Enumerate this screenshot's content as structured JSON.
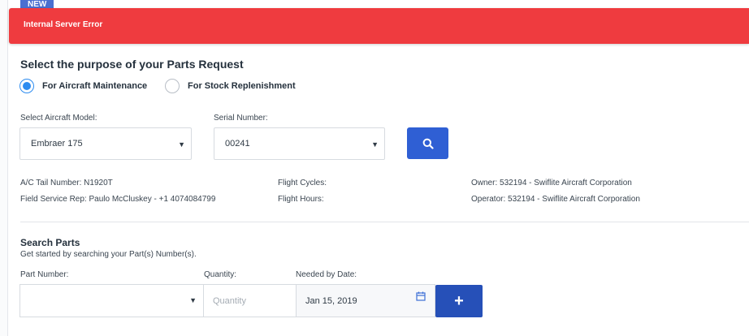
{
  "badge": {
    "new": "NEW"
  },
  "alert": {
    "message": "Internal Server Error",
    "color": "#ef3b3f"
  },
  "purpose": {
    "title": "Select the purpose of your Parts Request",
    "options": [
      {
        "label": "For Aircraft Maintenance",
        "selected": true
      },
      {
        "label": "For Stock Replenishment",
        "selected": false
      }
    ]
  },
  "aircraft": {
    "model_label": "Select Aircraft Model:",
    "model_value": "Embraer 175",
    "serial_label": "Serial Number:",
    "serial_value": "00241",
    "search_icon": "search-icon"
  },
  "details": {
    "tail_number": "A/C Tail Number: N1920T",
    "field_rep": "Field Service Rep: Paulo McCluskey - +1 4074084799",
    "flight_cycles": "Flight Cycles:",
    "flight_hours": "Flight Hours:",
    "owner": "Owner: 532194 - Swiflite Aircraft Corporation",
    "operator": "Operator: 532194 - Swiflite Aircraft Corporation"
  },
  "search_parts": {
    "title": "Search Parts",
    "subtitle": "Get started by searching your Part(s) Number(s).",
    "part_label": "Part Number:",
    "part_value": "",
    "quantity_label": "Quantity:",
    "quantity_placeholder": "Quantity",
    "date_label": "Needed by Date:",
    "date_value": "Jan 15, 2019",
    "add_label": "+"
  },
  "colors": {
    "primary": "#2f5fd4",
    "radio_accent": "#2d8cf0",
    "add_button": "#2650b8"
  }
}
